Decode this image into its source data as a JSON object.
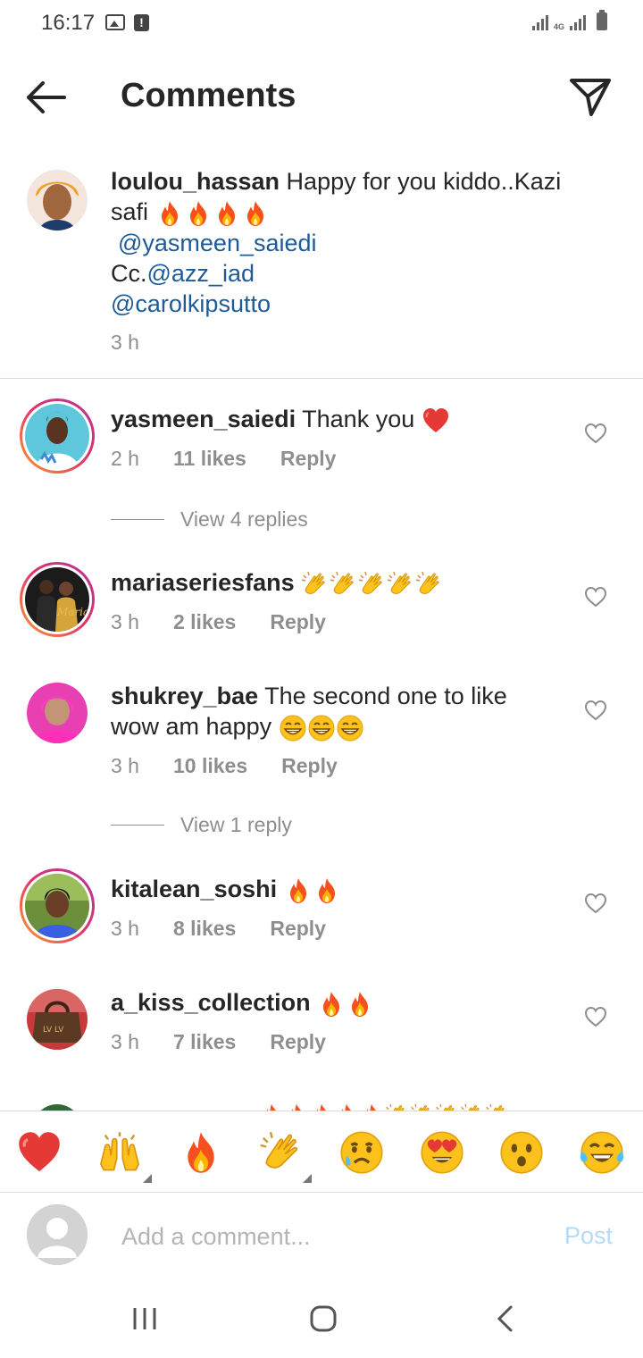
{
  "status_bar": {
    "time": "16:17",
    "network": "4G"
  },
  "header": {
    "title": "Comments"
  },
  "caption": {
    "username": "loulou_hassan",
    "text_line1": " Happy for you kiddo..Kazi",
    "text_line2": "safi",
    "mention1": "@yasmeen_saiedi",
    "mention2_prefix": "Cc.",
    "mention2": "@azz_iad",
    "mention3": "@carolkipsutto",
    "time": "3 h"
  },
  "comments": [
    {
      "username": "yasmeen_saiedi",
      "text": " Thank you",
      "time": "2 h",
      "likes": "11 likes",
      "reply": "Reply",
      "view_replies": "View 4 replies"
    },
    {
      "username": "mariaseriesfans",
      "text": "",
      "time": "3 h",
      "likes": "2 likes",
      "reply": "Reply"
    },
    {
      "username": "shukrey_bae",
      "text": " The second one to like",
      "text_line2": "wow am happy",
      "time": "3 h",
      "likes": "10 likes",
      "reply": "Reply",
      "view_replies": "View 1 reply"
    },
    {
      "username": "kitalean_soshi",
      "text": "",
      "time": "3 h",
      "likes": "8 likes",
      "reply": "Reply"
    },
    {
      "username": "a_kiss_collection",
      "text": "",
      "time": "3 h",
      "likes": "7 likes",
      "reply": "Reply"
    }
  ],
  "emoji_bar": [
    "red-heart",
    "raising-hands",
    "fire",
    "clapping-hands",
    "crying-face",
    "heart-eyes-face",
    "surprised-face",
    "tears-of-joy-face"
  ],
  "input": {
    "placeholder": "Add a comment...",
    "post_label": "Post"
  },
  "colors": {
    "mention": "#1d5b98",
    "post_disabled": "#b3dbf8",
    "meta": "#8e8e8e",
    "text": "#262626"
  }
}
